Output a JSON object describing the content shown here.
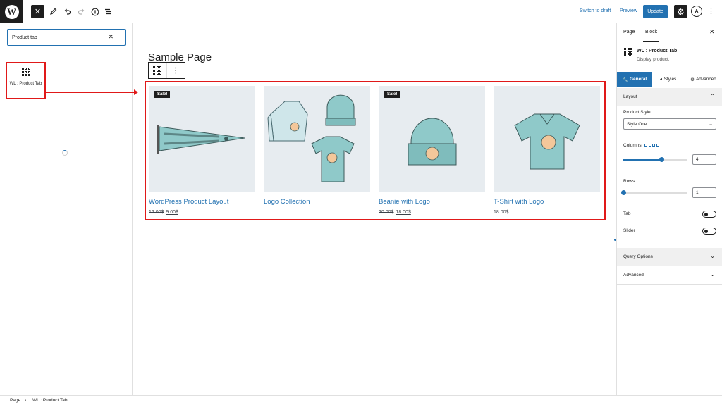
{
  "topbar": {
    "logo_glyph": "W",
    "switch_to_draft": "Switch to draft",
    "preview": "Preview",
    "update": "Update",
    "accent_color": "#2271b1"
  },
  "inserter": {
    "search_value": "Product tab",
    "search_clear": "✕",
    "result_label": "WL : Product Tab"
  },
  "canvas": {
    "page_title": "Sample Page",
    "products": [
      {
        "name": "WordPress Product Layout",
        "sale_badge": "Sale!",
        "old_price": "12.00$",
        "new_price": "9.00$",
        "price": ""
      },
      {
        "name": "Logo Collection",
        "sale_badge": "",
        "old_price": "",
        "new_price": "",
        "price": ""
      },
      {
        "name": "Beanie with Logo",
        "sale_badge": "Sale!",
        "old_price": "20.00$",
        "new_price": "18.00$",
        "price": ""
      },
      {
        "name": "T-Shirt with Logo",
        "sale_badge": "",
        "old_price": "",
        "new_price": "",
        "price": "18.00$"
      }
    ]
  },
  "sidebar": {
    "tabs": [
      "Page",
      "Block"
    ],
    "active_tab": "Block",
    "block_name": "WL : Product Tab",
    "block_desc": "Display product.",
    "sub_tabs": [
      "General",
      "Styles",
      "Advanced"
    ],
    "active_sub_tab": "General",
    "layout_title": "Layout",
    "product_style_label": "Product Style",
    "product_style_value": "Style One",
    "columns_label": "Columns",
    "columns_value": "4",
    "columns_fraction": 0.6,
    "rows_label": "Rows",
    "rows_value": "1",
    "rows_fraction": 0.0,
    "tab_label": "Tab",
    "slider_label": "Slider",
    "tab_enabled": false,
    "slider_enabled": false,
    "query_options": "Query Options",
    "advanced": "Advanced"
  },
  "footer": {
    "breadcrumb": [
      "Page",
      "WL : Product Tab"
    ],
    "separator": "›"
  }
}
